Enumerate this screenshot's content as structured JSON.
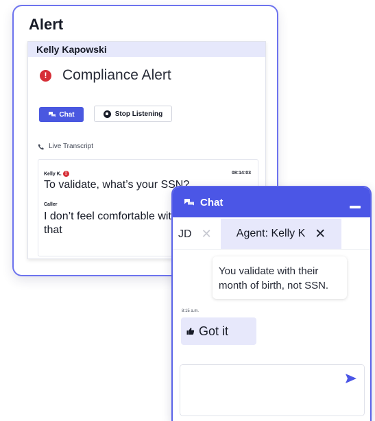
{
  "alert": {
    "title": "Alert",
    "agent_name": "Kelly Kapowski",
    "compliance_title": "Compliance Alert",
    "chat_button": "Chat",
    "stop_button": "Stop Listening",
    "live_transcript_label": "Live Transcript",
    "transcript": [
      {
        "speaker": "Kelly K.",
        "time": "08:14:03",
        "text": "To validate, what’s your SSN?"
      },
      {
        "speaker": "Caller",
        "text": "I don’t feel comfortable with",
        "text2": "that"
      }
    ]
  },
  "chat": {
    "title": "Chat",
    "tabs": [
      {
        "label": "JD",
        "close": "✕"
      },
      {
        "label": "Agent: Kelly K",
        "close": "✕"
      }
    ],
    "messages": [
      {
        "from": "agent",
        "text": "You validate with their month of birth, not SSN."
      },
      {
        "from": "user",
        "time": "8:15 a.m.",
        "text": "Got it"
      }
    ],
    "input_placeholder": ""
  },
  "colors": {
    "accent": "#4b56e6",
    "alert_red": "#d62f37",
    "highlight": "#e7e8fb"
  },
  "icons": [
    "exclamation-icon",
    "chat-bubble-icon",
    "stop-icon",
    "phone-icon",
    "minimize-icon",
    "close-icon",
    "thumbs-up-icon",
    "send-icon"
  ]
}
